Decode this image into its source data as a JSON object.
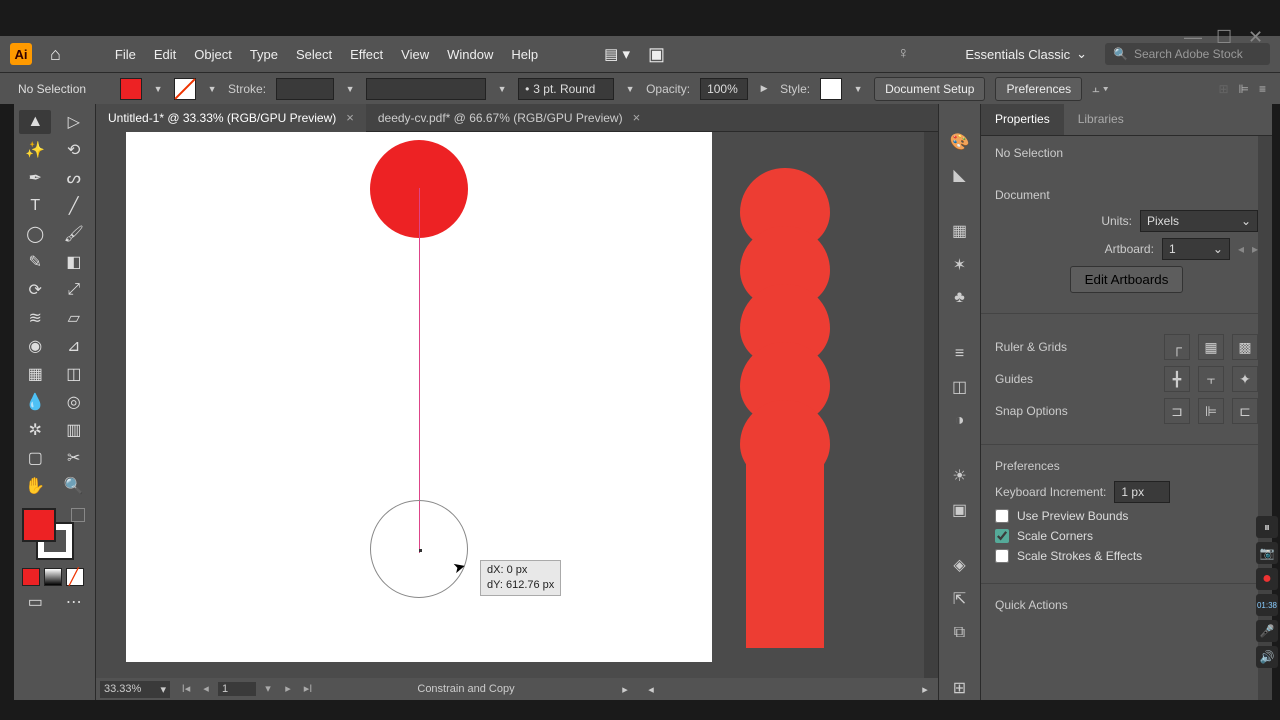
{
  "window": {
    "title": "Adobe Illustrator"
  },
  "menubar": {
    "logo_text": "Ai",
    "items": [
      "File",
      "Edit",
      "Object",
      "Type",
      "Select",
      "Effect",
      "View",
      "Window",
      "Help"
    ],
    "workspace": "Essentials Classic",
    "search_placeholder": "Search Adobe Stock"
  },
  "controlbar": {
    "selection": "No Selection",
    "stroke_label": "Stroke:",
    "brush_value": "3 pt. Round",
    "opacity_label": "Opacity:",
    "opacity_value": "100%",
    "style_label": "Style:",
    "doc_setup": "Document Setup",
    "preferences": "Preferences"
  },
  "tabs": [
    {
      "label": "Untitled-1* @ 33.33% (RGB/GPU Preview)",
      "active": true
    },
    {
      "label": "deedy-cv.pdf* @ 66.67% (RGB/GPU Preview)",
      "active": false
    }
  ],
  "canvas": {
    "tooltip_dx": "dX: 0 px",
    "tooltip_dy": "dY: 612.76 px"
  },
  "statusbar": {
    "zoom": "33.33%",
    "page": "1",
    "mode": "Constrain and Copy"
  },
  "properties": {
    "tabs": [
      "Properties",
      "Libraries"
    ],
    "no_selection": "No Selection",
    "document_head": "Document",
    "units_label": "Units:",
    "units_value": "Pixels",
    "artboard_label": "Artboard:",
    "artboard_value": "1",
    "edit_artboards": "Edit Artboards",
    "ruler_grids": "Ruler & Grids",
    "guides": "Guides",
    "snap_options": "Snap Options",
    "preferences_head": "Preferences",
    "keyboard_inc_label": "Keyboard Increment:",
    "keyboard_inc_value": "1 px",
    "use_preview_bounds": "Use Preview Bounds",
    "scale_corners": "Scale Corners",
    "scale_strokes": "Scale Strokes & Effects",
    "quick_actions": "Quick Actions"
  }
}
